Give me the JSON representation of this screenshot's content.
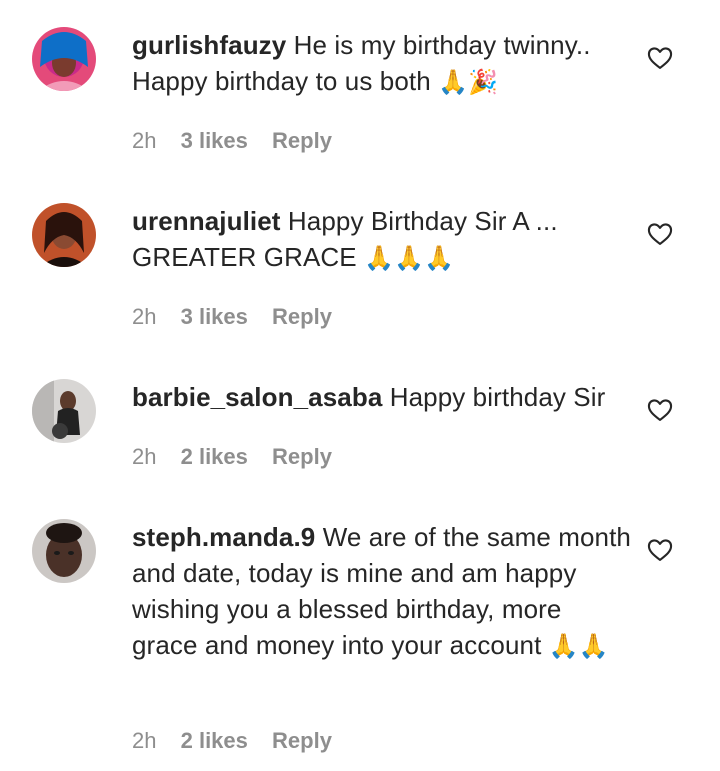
{
  "comments": [
    {
      "username": "gurlishfauzy",
      "text": "He is my birthday twinny.. Happy birthday to us both",
      "emoji": "🙏🎉",
      "time": "2h",
      "likes": "3 likes",
      "reply": "Reply"
    },
    {
      "username": "urennajuliet",
      "text": "Happy Birthday Sir A ... GREATER GRACE",
      "emoji": "🙏🙏🙏",
      "time": "2h",
      "likes": "3 likes",
      "reply": "Reply"
    },
    {
      "username": "barbie_salon_asaba",
      "text": "Happy birthday Sir",
      "emoji": "",
      "time": "2h",
      "likes": "2 likes",
      "reply": "Reply"
    },
    {
      "username": "steph.manda.9",
      "text": "We are of the same month and date, today is mine and am happy wishing you a blessed birthday, more grace and money into your account",
      "emoji": "🙏🙏",
      "time": "2h",
      "likes": "2 likes",
      "reply": "Reply"
    }
  ],
  "icons": {
    "like": "heart-outline-icon"
  },
  "colors": {
    "text": "#262626",
    "meta": "#8e8e8e"
  }
}
